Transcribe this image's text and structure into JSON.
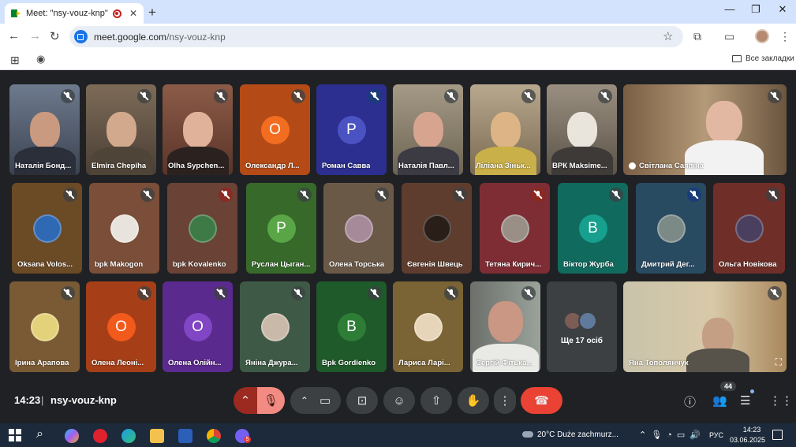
{
  "browser": {
    "tab_title": "Meet: \"nsy-vouz-knp\"",
    "url_host": "meet.google.com",
    "url_path": "/nsy-vouz-knp",
    "bookmarks_all": "Все закладки"
  },
  "colors": {
    "meet_bg": "#202124",
    "hangup": "#ea4335",
    "mic_off_active": "#f28b82",
    "chrome_tab_strip": "#d3e3fd",
    "taskbar": "#1c2a3b"
  },
  "tiles": [
    {
      "name": "Наталія Бонд...",
      "mute": "grey"
    },
    {
      "name": "Elmira Chepiha",
      "mute": "grey"
    },
    {
      "name": "Olha Sypchen...",
      "mute": "grey"
    },
    {
      "name": "Олександр Л...",
      "mute": "grey",
      "letter": "О"
    },
    {
      "name": "Роман Савва",
      "mute": "blue",
      "letter": "Р"
    },
    {
      "name": "Наталія Павл...",
      "mute": "grey"
    },
    {
      "name": "Ліліана Зіньк...",
      "mute": "grey"
    },
    {
      "name": "ВРК Maksime...",
      "mute": "grey"
    },
    {
      "name": "Світлана Саяпіна",
      "mute": "grey",
      "hand": true
    },
    {
      "name": "Oksana Volos...",
      "mute": "grey"
    },
    {
      "name": "bpk Makogon",
      "mute": "grey"
    },
    {
      "name": "bpk Kovalenko",
      "mute": "grey"
    },
    {
      "name": "Руслан Цыган...",
      "mute": "grey",
      "letter": "Р"
    },
    {
      "name": "Олена Торська",
      "mute": "grey"
    },
    {
      "name": "Євгенія Швець",
      "mute": "grey"
    },
    {
      "name": "Тетяна Кирич...",
      "mute": "grey"
    },
    {
      "name": "Віктор Журба",
      "mute": "grey",
      "letter": "В"
    },
    {
      "name": "Дмитрий Дег...",
      "mute": "blue"
    },
    {
      "name": "Ольга Новікова",
      "mute": "grey"
    },
    {
      "name": "Ірина Арапова",
      "mute": "grey"
    },
    {
      "name": "Олена Леоні...",
      "mute": "grey",
      "letter": "О"
    },
    {
      "name": "Олена Олійн...",
      "mute": "grey",
      "letter": "О"
    },
    {
      "name": "Яніна Джура...",
      "mute": "grey"
    },
    {
      "name": "Bpk Gordienko",
      "mute": "grey",
      "letter": "B"
    },
    {
      "name": "Лариса Ларі...",
      "mute": "grey"
    },
    {
      "name": "Сергій Фітька...",
      "mute": "grey"
    },
    {
      "name": "Яна Тополянчук",
      "mute": "grey"
    }
  ],
  "more_tile": {
    "label": "Ще 17 осіб"
  },
  "meeting": {
    "time": "14:23",
    "separator": "|",
    "code": "nsy-vouz-knp",
    "participant_count": "44"
  },
  "taskbar": {
    "weather_temp": "20°C",
    "weather_text": "Duże zachmurz...",
    "lang": "РУС",
    "time": "14:23",
    "date": "03.06.2025",
    "viber_badge": "5"
  }
}
